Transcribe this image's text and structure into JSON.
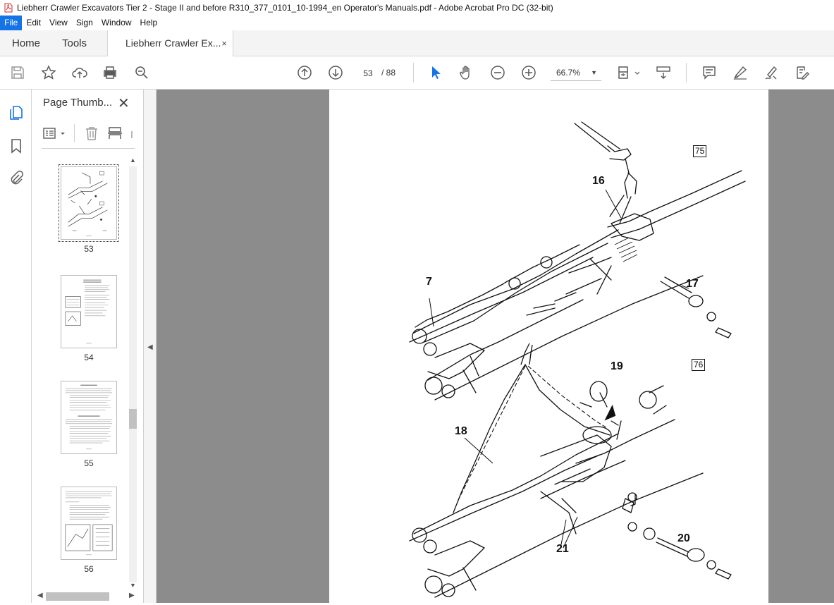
{
  "window": {
    "title": "Liebherr Crawler Excavators Tier 2 - Stage II and before  R310_377_0101_10-1994_en Operator's Manuals.pdf - Adobe Acrobat Pro DC (32-bit)"
  },
  "menu": [
    "File",
    "Edit",
    "View",
    "Sign",
    "Window",
    "Help"
  ],
  "tabs": {
    "home": "Home",
    "tools": "Tools",
    "document": "Liebherr Crawler Ex...",
    "close": "×"
  },
  "toolbar": {
    "current_page": "53",
    "page_total": "/ 88",
    "zoom": "66.7%"
  },
  "panel": {
    "title": "Page Thumb...",
    "close": "✕",
    "thumbnails": [
      {
        "label": "53",
        "selected": true
      },
      {
        "label": "54",
        "selected": false
      },
      {
        "label": "55",
        "selected": false
      },
      {
        "label": "56",
        "selected": false
      }
    ]
  },
  "document": {
    "figure_labels": [
      "75",
      "76"
    ],
    "callouts": {
      "c16": "16",
      "c7": "7",
      "c17": "17",
      "c19": "19",
      "c18": "18",
      "c20": "20",
      "c21": "21"
    }
  },
  "colors": {
    "accent": "#1473e6",
    "doc_background": "#8c8c8c",
    "icon_gray": "#5a5a5a"
  }
}
